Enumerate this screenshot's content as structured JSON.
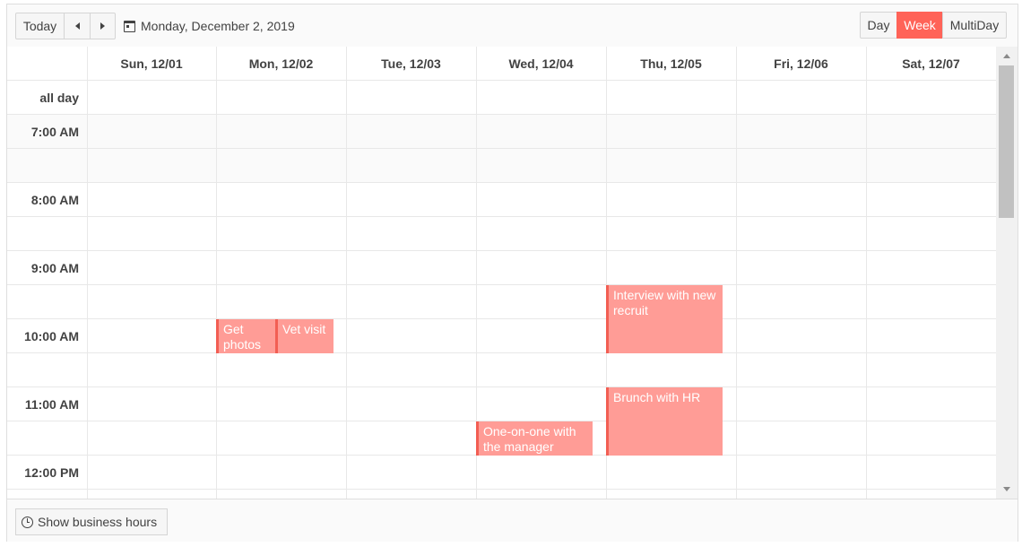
{
  "toolbar": {
    "today_label": "Today",
    "prev_icon": "caret-left-icon",
    "next_icon": "caret-right-icon",
    "date_icon": "calendar-icon",
    "date_label": "Monday, December 2, 2019",
    "views": [
      {
        "label": "Day",
        "selected": false
      },
      {
        "label": "Week",
        "selected": true
      },
      {
        "label": "MultiDay",
        "selected": false
      }
    ]
  },
  "days": [
    "Sun, 12/01",
    "Mon, 12/02",
    "Tue, 12/03",
    "Wed, 12/04",
    "Thu, 12/05",
    "Fri, 12/06",
    "Sat, 12/07"
  ],
  "allday_label": "all day",
  "times": [
    "7:00 AM",
    "8:00 AM",
    "9:00 AM",
    "10:00 AM",
    "11:00 AM",
    "12:00 PM"
  ],
  "events": [
    {
      "title": "Get photos",
      "day": "Mon, 12/02",
      "start": "10:00 AM",
      "end": "10:30 AM"
    },
    {
      "title": "Vet visit",
      "day": "Mon, 12/02",
      "start": "10:00 AM",
      "end": "10:30 AM"
    },
    {
      "title": "Interview with new recruit",
      "day": "Thu, 12/05",
      "start": "9:30 AM",
      "end": "10:30 AM"
    },
    {
      "title": "Brunch with HR",
      "day": "Thu, 12/05",
      "start": "11:00 AM",
      "end": "12:00 PM"
    },
    {
      "title": "One-on-one with the manager",
      "day": "Wed, 12/04",
      "start": "11:30 AM",
      "end": "12:00 PM"
    }
  ],
  "colors": {
    "accent": "#ff6358",
    "event_bg": "#ff9c96",
    "event_border": "#f25e53"
  },
  "footer": {
    "business_hours_icon": "clock-icon",
    "business_hours_label": "Show business hours"
  }
}
